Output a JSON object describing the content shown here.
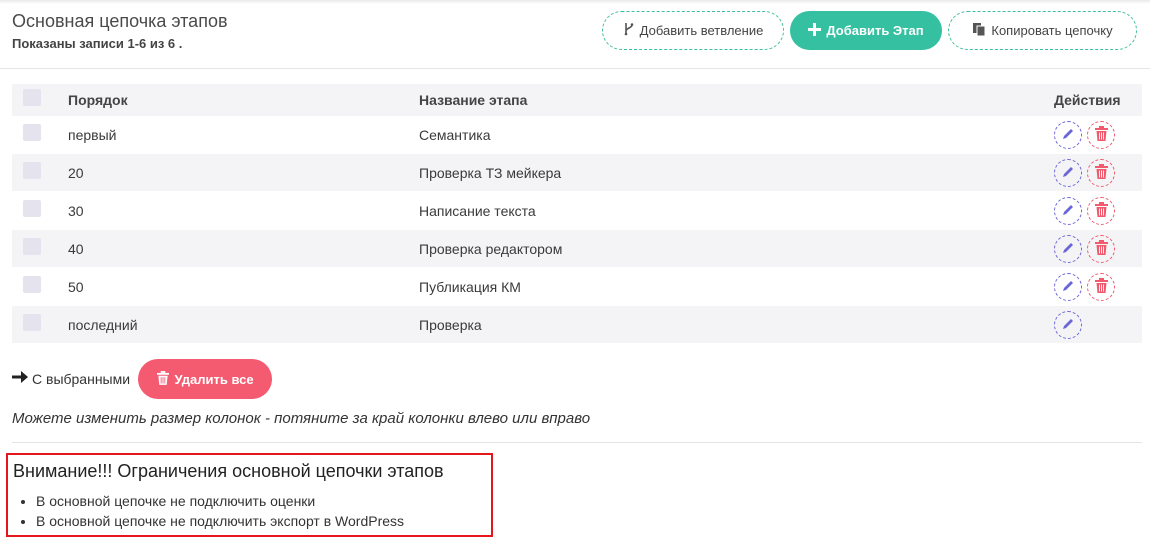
{
  "header": {
    "title": "Основная цепочка этапов",
    "subtitle": "Показаны записи 1-6 из 6 .",
    "buttons": {
      "add_branch": "Добавить ветвление",
      "add_stage": "Добавить Этап",
      "copy_chain": "Копировать цепочку"
    }
  },
  "table": {
    "columns": {
      "order": "Порядок",
      "name": "Название этапа",
      "actions": "Действия"
    },
    "rows": [
      {
        "order": "первый",
        "name": "Семантика",
        "deletable": true
      },
      {
        "order": "20",
        "name": "Проверка ТЗ мейкера",
        "deletable": true
      },
      {
        "order": "30",
        "name": "Написание текста",
        "deletable": true
      },
      {
        "order": "40",
        "name": "Проверка редактором",
        "deletable": true
      },
      {
        "order": "50",
        "name": "Публикация КМ",
        "deletable": true
      },
      {
        "order": "последний",
        "name": "Проверка",
        "deletable": false
      }
    ]
  },
  "bulk": {
    "label": "С выбранными",
    "delete_all": "Удалить все"
  },
  "hint": "Можете изменить размер колонок - потяните за край колонки влево или вправо",
  "warning": {
    "title": "Внимание!!! Ограничения основной цепочки этапов",
    "items": [
      "В основной цепочке не подключить оценки",
      "В основной цепочке не подключить экспорт в WordPress"
    ]
  },
  "colors": {
    "accent_green": "#35c0a1",
    "danger": "#f45a70",
    "edit_icon": "#6b66d8",
    "warning_border": "#e3171c"
  },
  "icons": {
    "branch": "branch-icon",
    "add": "plus-icon",
    "copy": "copy-icon",
    "edit": "pencil-icon",
    "delete": "trash-icon",
    "arrow": "arrow-right-icon"
  }
}
